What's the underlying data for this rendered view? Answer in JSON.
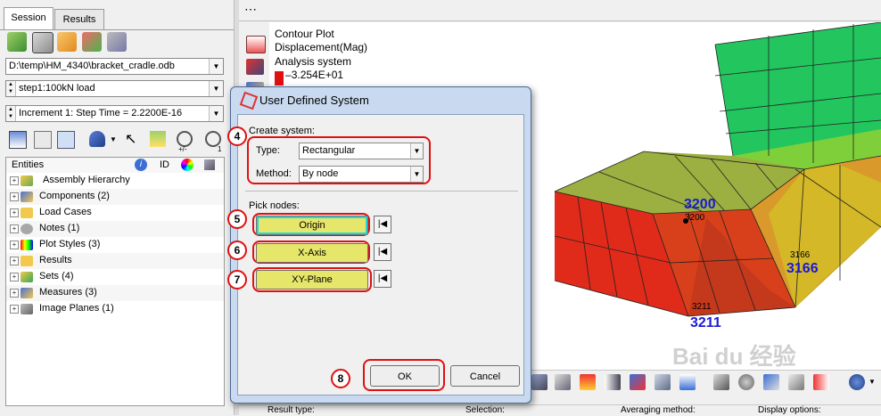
{
  "left_panel": {
    "tabs": [
      {
        "label": "Session"
      },
      {
        "label": "Results"
      }
    ],
    "file_path": "D:\\temp\\HM_4340\\bracket_cradle.odb",
    "load_step": "step1:100kN load",
    "increment": "Increment     1: Step Time =  2.2200E-16",
    "entities_header": {
      "label": "Entities",
      "id_label": "ID"
    },
    "entities": [
      {
        "label": "Assembly Hierarchy"
      },
      {
        "label": "Components (2)"
      },
      {
        "label": "Load Cases"
      },
      {
        "label": "Notes (1)"
      },
      {
        "label": "Plot Styles (3)"
      },
      {
        "label": "Results"
      },
      {
        "label": "Sets  (4)"
      },
      {
        "label": "Measures (3)"
      },
      {
        "label": "Image Planes (1)"
      }
    ],
    "toolbar_badges": {
      "plus_minus": "+/-",
      "one": "1"
    }
  },
  "viewport": {
    "legend": {
      "line1": "Contour Plot",
      "line2": "Displacement(Mag)",
      "line3": "Analysis system",
      "max_value": "3.254E+01"
    },
    "node_labels": [
      {
        "small": "3200",
        "big": "3200"
      },
      {
        "small": "3166",
        "big": "3166"
      },
      {
        "small": "3211",
        "big": "3211"
      }
    ],
    "watermark": "Bai du 经验"
  },
  "status_bar": {
    "result_type": "Result type:",
    "selection": "Selection:",
    "averaging": "Averaging method:",
    "display": "Display options:"
  },
  "dialog": {
    "title": "User Defined System",
    "create_system_label": "Create system:",
    "type_label": "Type:",
    "type_value": "Rectangular",
    "method_label": "Method:",
    "method_value": "By node",
    "pick_nodes_label": "Pick nodes:",
    "buttons": {
      "origin": "Origin",
      "x_axis": "X-Axis",
      "xy_plane": "XY-Plane",
      "ok": "OK",
      "cancel": "Cancel"
    },
    "step_numbers": [
      "4",
      "5",
      "6",
      "7",
      "8"
    ],
    "skip_glyph": "|◀"
  },
  "colors": {
    "accent_red": "#e01010",
    "pick_yellow": "#e6e66a",
    "active_cyan": "#27d7d7",
    "node_blue": "#1a1ad6"
  }
}
